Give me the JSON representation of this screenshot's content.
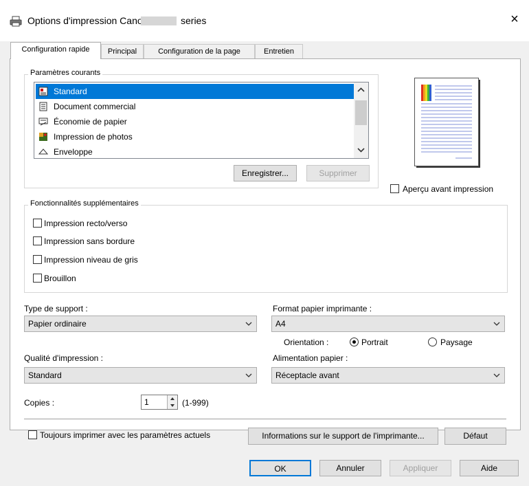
{
  "window": {
    "title": "Options d'impression Canon",
    "series": "series",
    "close_glyph": "×"
  },
  "tabs": [
    {
      "label": "Configuration rapide",
      "active": true
    },
    {
      "label": "Principal",
      "active": false
    },
    {
      "label": "Configuration de la page",
      "active": false
    },
    {
      "label": "Entretien",
      "active": false
    }
  ],
  "current_settings": {
    "label": "Paramètres courants",
    "items": [
      {
        "label": "Standard",
        "selected": true,
        "icon": "standard-doc-icon"
      },
      {
        "label": "Document commercial",
        "selected": false,
        "icon": "business-document-icon"
      },
      {
        "label": "Économie de papier",
        "selected": false,
        "icon": "paper-saving-icon"
      },
      {
        "label": "Impression de photos",
        "selected": false,
        "icon": "photo-print-icon"
      },
      {
        "label": "Enveloppe",
        "selected": false,
        "icon": "envelope-icon"
      }
    ],
    "save_button": "Enregistrer...",
    "delete_button": "Supprimer"
  },
  "preview": {
    "label": "Aperçu avant impression",
    "checked": false
  },
  "extra_features": {
    "label": "Fonctionnalités supplémentaires",
    "items": [
      {
        "label": "Impression recto/verso",
        "checked": false
      },
      {
        "label": "Impression sans bordure",
        "checked": false
      },
      {
        "label": "Impression niveau de gris",
        "checked": false
      },
      {
        "label": "Brouillon",
        "checked": false
      }
    ]
  },
  "media_type": {
    "label": "Type de support :",
    "value": "Papier ordinaire"
  },
  "paper_size": {
    "label": "Format papier imprimante :",
    "value": "A4"
  },
  "orientation": {
    "label": "Orientation :",
    "portrait": "Portrait",
    "landscape": "Paysage",
    "selected": "portrait"
  },
  "print_quality": {
    "label": "Qualité d'impression :",
    "value": "Standard"
  },
  "paper_source": {
    "label": "Alimentation papier :",
    "value": "Réceptacle avant"
  },
  "copies": {
    "label": "Copies :",
    "value": "1",
    "range": "(1-999)"
  },
  "always_print": {
    "label": "Toujours imprimer avec les paramètres actuels",
    "checked": false
  },
  "media_info_button": "Informations sur le support de l'imprimante...",
  "defaults_button": "Défaut",
  "footer": {
    "ok": "OK",
    "cancel": "Annuler",
    "apply": "Appliquer",
    "help": "Aide"
  },
  "colors": {
    "selection": "#0078d7",
    "panel_bg": "#ffffff",
    "dialog_bg": "#f0f0f0"
  }
}
